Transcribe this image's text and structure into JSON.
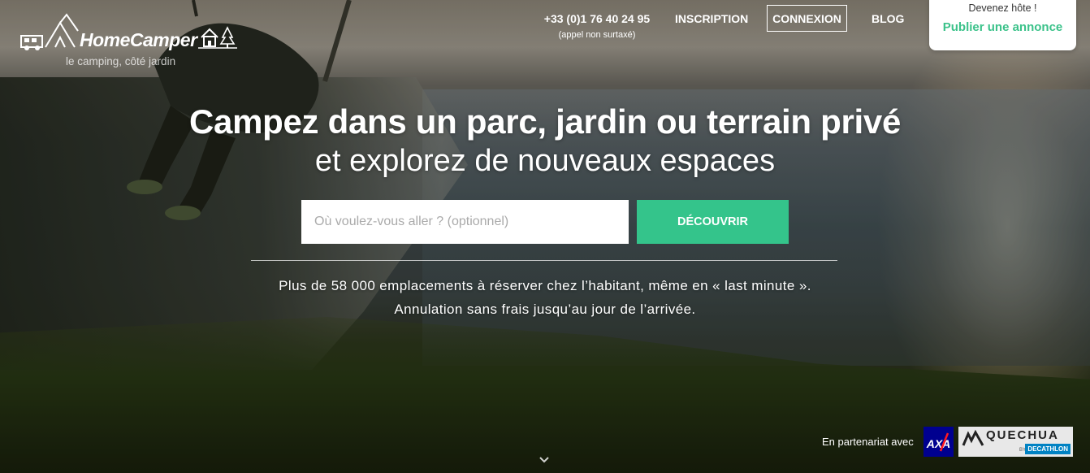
{
  "brand": {
    "name": "HomeCamper",
    "tagline": "le camping, côté jardin"
  },
  "nav": {
    "phone_number": "+33 (0)1 76 40 24 95",
    "phone_note": "(appel non surtaxé)",
    "inscription_label": "INSCRIPTION",
    "connexion_label": "CONNEXION",
    "blog_label": "BLOG"
  },
  "host_card": {
    "label": "Devenez hôte !",
    "link_label": "Publier une annonce"
  },
  "hero": {
    "headline": "Campez dans un parc, jardin ou terrain privé",
    "subhead": "et explorez de nouveaux espaces",
    "search_placeholder": "Où voulez-vous aller ? (optionnel)",
    "search_value": "",
    "discover_label": "DÉCOUVRIR",
    "tagline_line1": "Plus de 58 000 emplacements à réserver chez l’habitant, même en « last minute ».",
    "tagline_line2": "Annulation sans frais jusqu’au jour de l’arrivée."
  },
  "partners": {
    "label": "En partenariat avec",
    "axa_logo_text": "AXA",
    "quechua_logo_text": "QUECHUA",
    "quechua_by": "BY",
    "decathlon_text": "DECATHLON"
  },
  "colors": {
    "accent_green": "#34c48b",
    "host_link_green": "#3bc28a",
    "axa_blue": "#00008f",
    "axa_red": "#ff1721",
    "decathlon_blue": "#0082c3"
  },
  "icons": {
    "scroll": "chevron-down-icon",
    "logo_rv": "camper-van-icon",
    "logo_tent": "tent-icon",
    "logo_house": "house-icon",
    "logo_tree": "tree-icon"
  }
}
